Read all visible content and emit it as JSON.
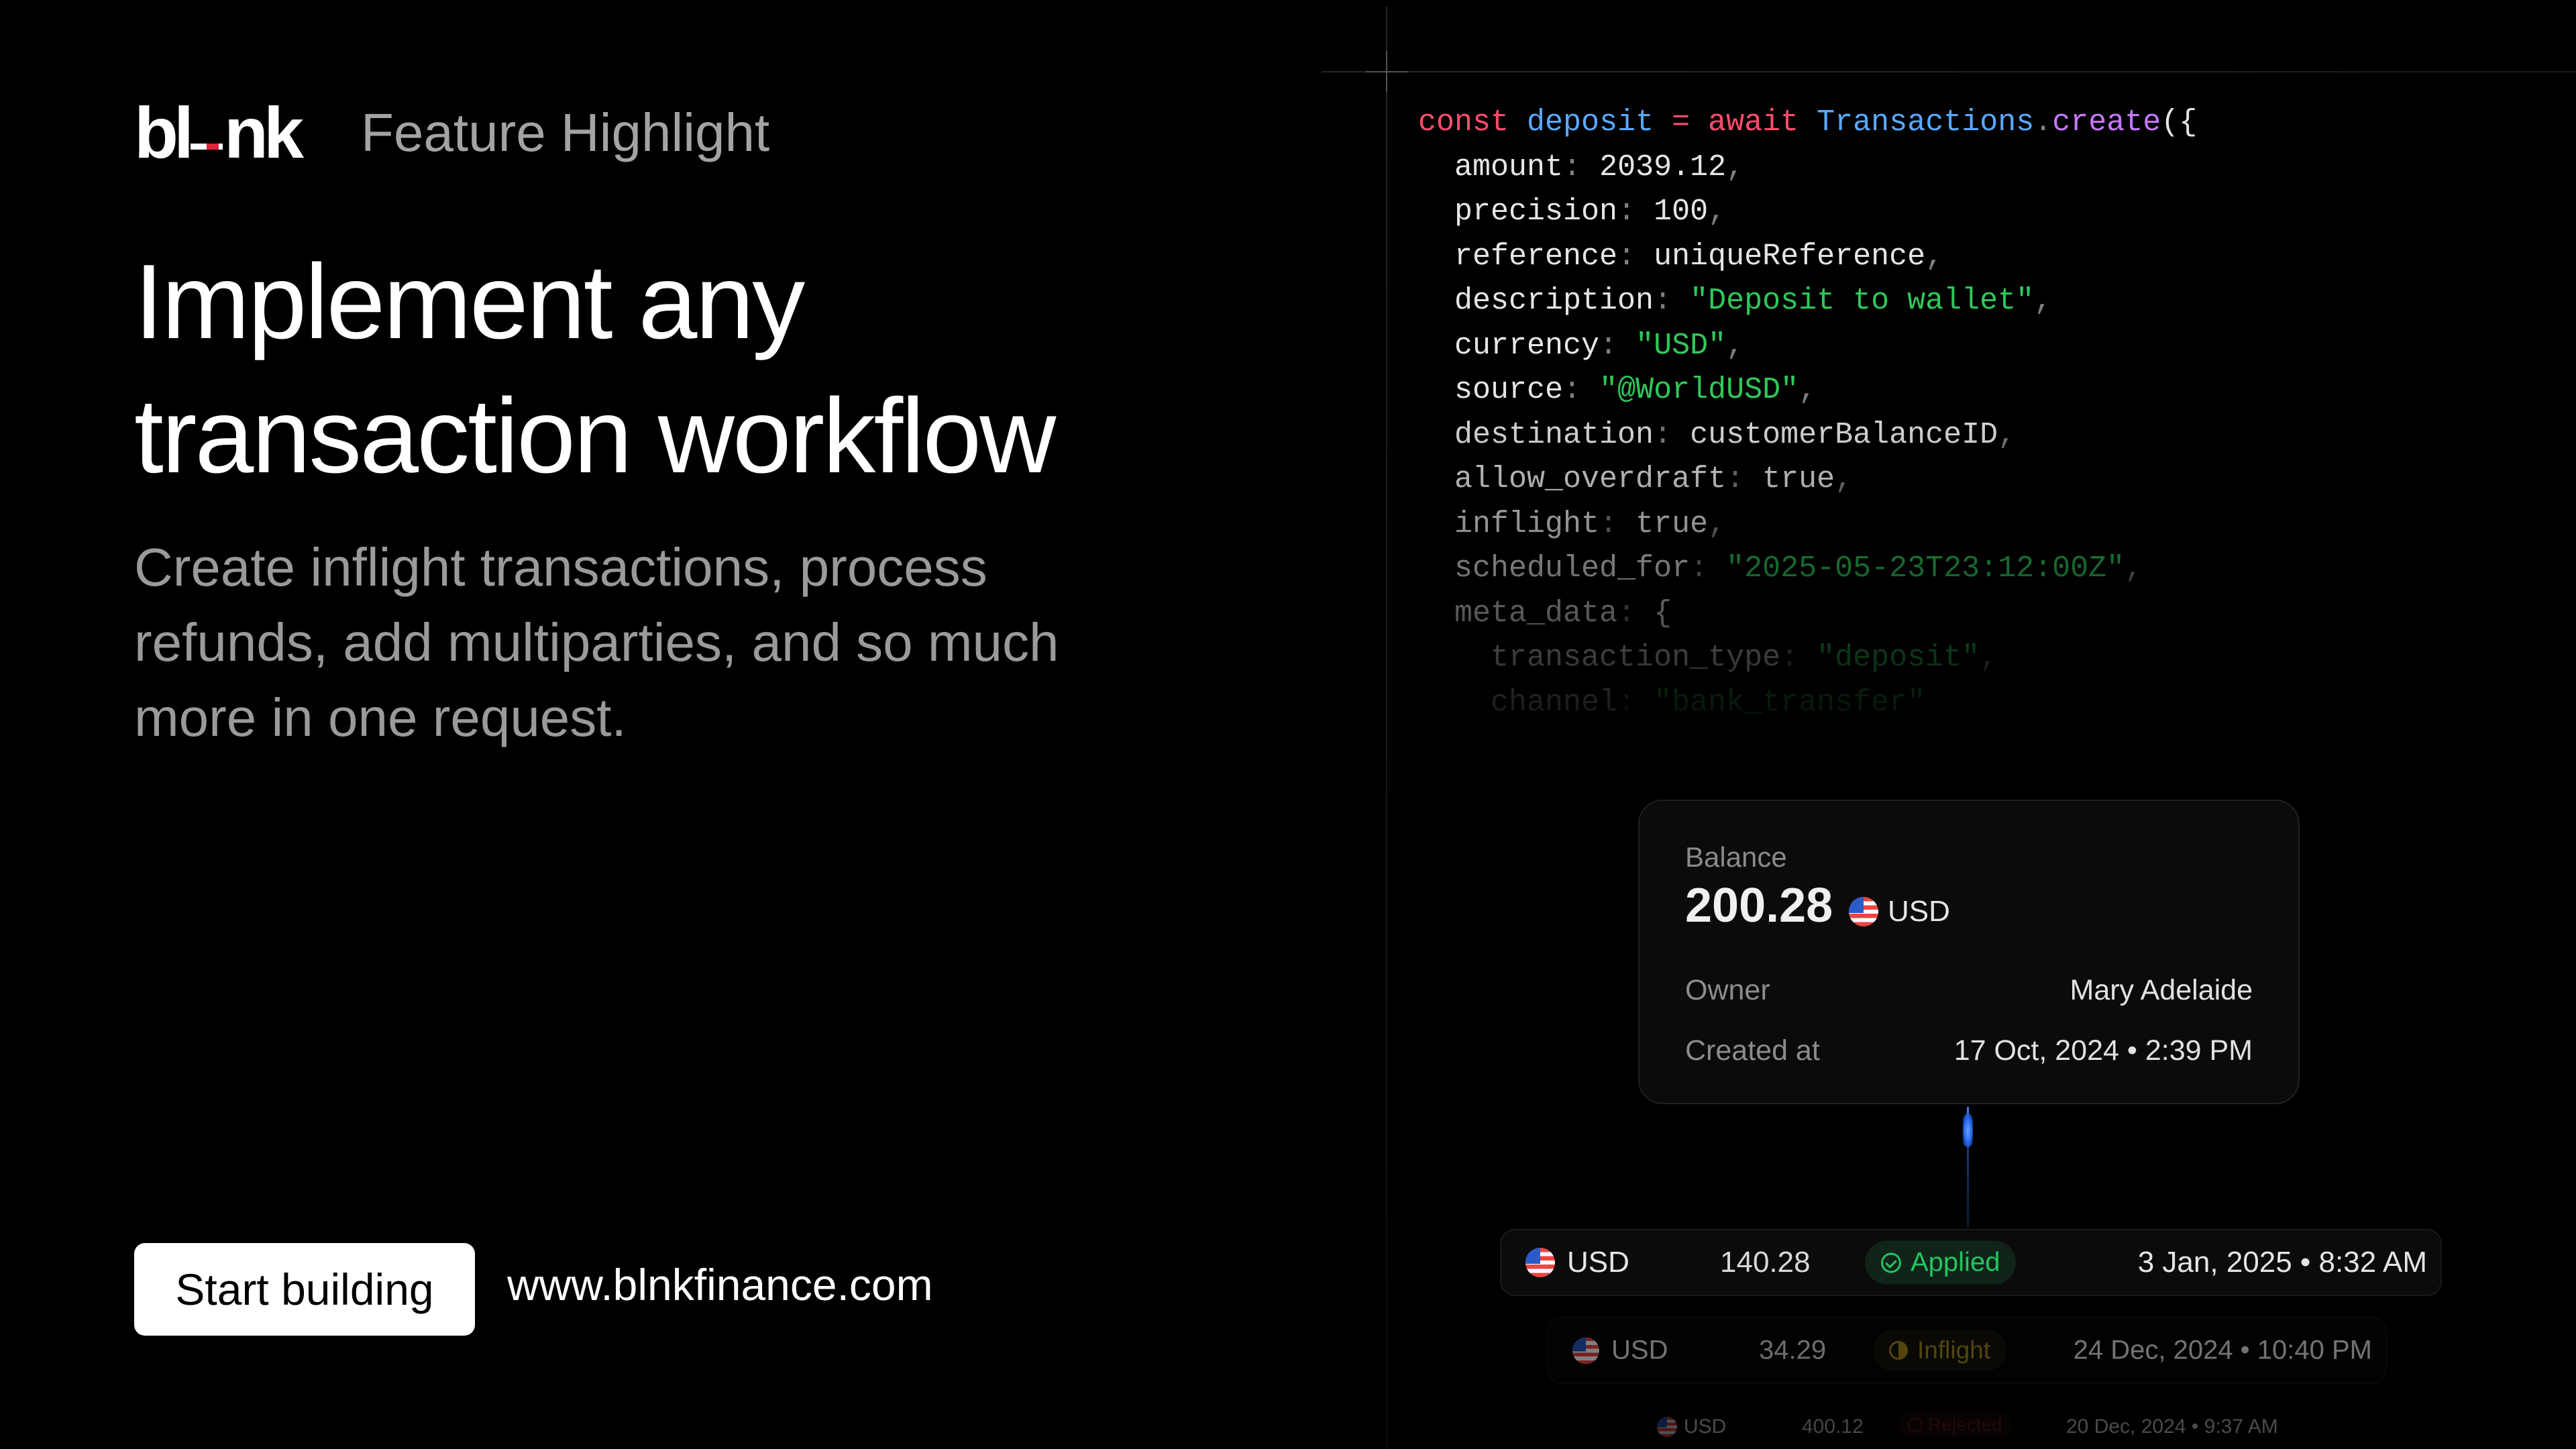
{
  "brand": {
    "logo_left": "bl",
    "logo_right": "nk",
    "feature_label": "Feature Highlight"
  },
  "hero": {
    "headline_line1": "Implement any",
    "headline_line2": "transaction workflow",
    "subtitle": "Create inflight transactions, process refunds, add multiparties, and so much more in one request."
  },
  "cta": {
    "button_label": "Start building",
    "url": "www.blnkfinance.com"
  },
  "code": {
    "kw_const": "const",
    "var_name": "deposit",
    "op_eq": "=",
    "kw_await": "await",
    "obj": "Transactions",
    "dot": ".",
    "fn": "create",
    "open": "({",
    "fields": [
      {
        "key": "amount",
        "value": "2039.12",
        "type": "num"
      },
      {
        "key": "precision",
        "value": "100",
        "type": "num"
      },
      {
        "key": "reference",
        "value": "uniqueReference",
        "type": "ident"
      },
      {
        "key": "description",
        "value": "\"Deposit to wallet\"",
        "type": "str"
      },
      {
        "key": "currency",
        "value": "\"USD\"",
        "type": "str"
      },
      {
        "key": "source",
        "value": "\"@WorldUSD\"",
        "type": "str"
      },
      {
        "key": "destination",
        "value": "customerBalanceID",
        "type": "ident"
      },
      {
        "key": "allow_overdraft",
        "value": "true",
        "type": "ident"
      },
      {
        "key": "inflight",
        "value": "true",
        "type": "ident"
      },
      {
        "key": "scheduled_for",
        "value": "\"2025-05-23T23:12:00Z\"",
        "type": "str"
      }
    ],
    "meta_key": "meta_data",
    "meta_open": "{",
    "meta_fields": [
      {
        "key": "transaction_type",
        "value": "\"deposit\""
      },
      {
        "key": "channel",
        "value": "\"bank_transfer\""
      }
    ]
  },
  "balance_card": {
    "label": "Balance",
    "amount": "200.28",
    "currency": "USD",
    "owner_label": "Owner",
    "owner_value": "Mary Adelaide",
    "created_label": "Created at",
    "created_value": "17 Oct, 2024 • 2:39 PM"
  },
  "transactions": [
    {
      "currency": "USD",
      "amount": "140.28",
      "status": "Applied",
      "date": "3 Jan, 2025 • 8:32 AM"
    },
    {
      "currency": "USD",
      "amount": "34.29",
      "status": "Inflight",
      "date": "24 Dec, 2024 • 10:40 PM"
    },
    {
      "currency": "USD",
      "amount": "400.12",
      "status": "Rejected",
      "date": "20 Dec, 2024 • 9:37 AM"
    }
  ],
  "colors": {
    "background": "#000000",
    "code_keyword": "#ff4d6d",
    "code_identifier": "#5aa9ff",
    "code_function": "#c678ff",
    "code_string": "#2fc85a",
    "status_applied": "#22c55e",
    "status_inflight": "#a38a1a",
    "status_rejected": "#6e1d1d",
    "connector": "#3b82f6"
  },
  "icons": {
    "flag": "us-flag-icon",
    "applied": "check-circle-icon",
    "inflight": "half-circle-icon",
    "rejected": "x-circle-icon"
  }
}
